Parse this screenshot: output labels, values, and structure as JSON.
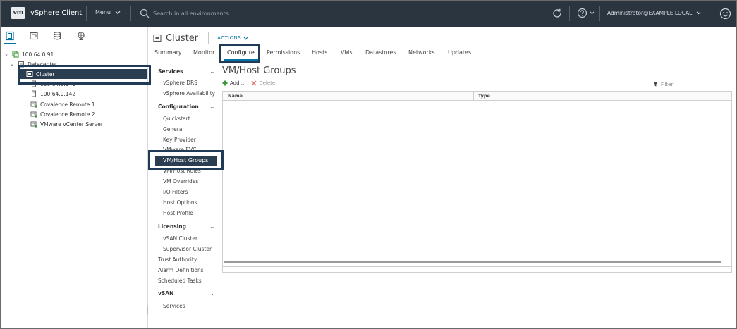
{
  "header": {
    "logo_text": "vm",
    "app_title": "vSphere Client",
    "menu_label": "Menu",
    "search_placeholder": "Search in all environments",
    "user": "Administrator@EXAMPLE.LOCAL"
  },
  "nav_tree": {
    "items": [
      {
        "label": "100.64.0.91",
        "icon": "vcenter-icon"
      },
      {
        "label": "Datacenter",
        "icon": "datacenter-icon"
      },
      {
        "label": "Cluster",
        "icon": "cluster-icon"
      },
      {
        "label": "100.64.0.141",
        "icon": "host-icon"
      },
      {
        "label": "100.64.0.142",
        "icon": "host-icon"
      },
      {
        "label": "Covalence Remote 1",
        "icon": "vm-icon"
      },
      {
        "label": "Covalence Remote 2",
        "icon": "vm-icon"
      },
      {
        "label": "VMware vCenter Server",
        "icon": "vm-icon"
      }
    ]
  },
  "object": {
    "title": "Cluster",
    "actions_label": "ACTIONS"
  },
  "tabs": [
    {
      "label": "Summary"
    },
    {
      "label": "Monitor"
    },
    {
      "label": "Configure"
    },
    {
      "label": "Permissions"
    },
    {
      "label": "Hosts"
    },
    {
      "label": "VMs"
    },
    {
      "label": "Datastores"
    },
    {
      "label": "Networks"
    },
    {
      "label": "Updates"
    }
  ],
  "subnav": {
    "services": "Services",
    "vsphere_drs": "vSphere DRS",
    "vsphere_availability": "vSphere Availability",
    "configuration": "Configuration",
    "quickstart": "Quickstart",
    "general": "General",
    "key_provider": "Key Provider",
    "vmware_evc": "VMware EVC",
    "vm_host_groups": "VM/Host Groups",
    "vm_host_rules": "VM/Host Rules",
    "vm_overrides": "VM Overrides",
    "io_filters": "I/O Filters",
    "host_options": "Host Options",
    "host_profile": "Host Profile",
    "licensing": "Licensing",
    "vsan_cluster": "vSAN Cluster",
    "supervisor_cluster": "Supervisor Cluster",
    "trust_authority": "Trust Authority",
    "alarm_definitions": "Alarm Definitions",
    "scheduled_tasks": "Scheduled Tasks",
    "vsan": "vSAN",
    "vsan_services": "Services"
  },
  "panel": {
    "title": "VM/Host Groups",
    "add_label": "Add...",
    "delete_label": "Delete",
    "filter_placeholder": "Filter",
    "col_name": "Name",
    "col_type": "Type"
  },
  "colors": {
    "header_bg": "#2b3540",
    "selection_bg": "#2b3d50",
    "accent": "#0072a3",
    "highlight_border": "#1f3b57"
  }
}
